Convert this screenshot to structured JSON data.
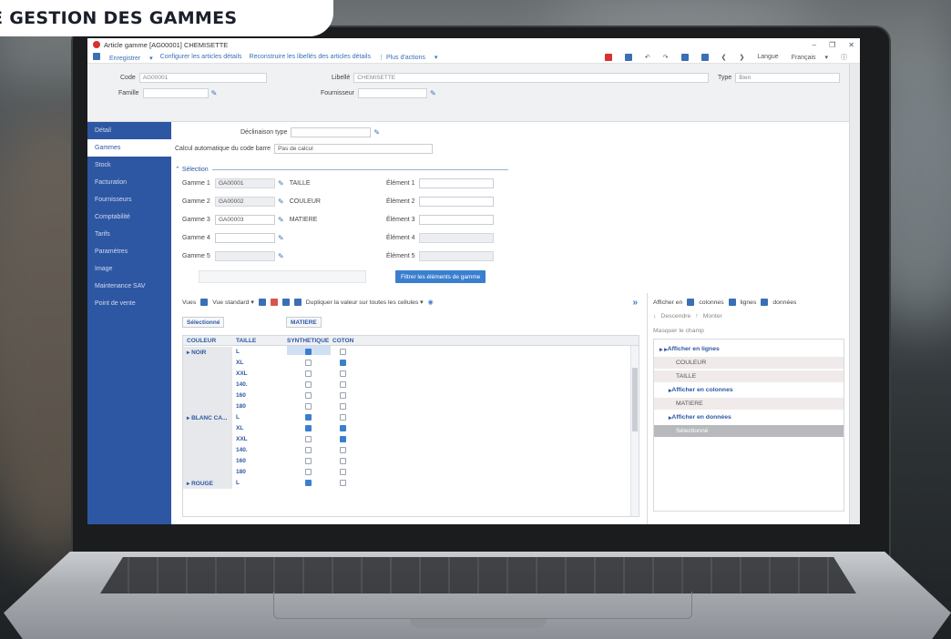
{
  "banner": {
    "text": "E GESTION DES GAMMES"
  },
  "window": {
    "title": "Article gamme [AG00001] CHEMISETTE",
    "controls": [
      "–",
      "❐",
      "✕"
    ]
  },
  "toolbar": {
    "save": "Enregistrer",
    "configure": "Configurer les articles détails",
    "rebuild": "Reconstruire les libellés des articles détails",
    "more": "Plus d'actions",
    "language_label": "Langue",
    "language_value": "Français"
  },
  "header": {
    "code_label": "Code",
    "code_value": "AG00001",
    "libelle_label": "Libellé",
    "libelle_value": "CHEMISETTE",
    "type_label": "Type",
    "type_value": "Bien",
    "famille_label": "Famille",
    "fournisseur_label": "Fournisseur"
  },
  "sidebar": {
    "items": [
      {
        "label": "Détail"
      },
      {
        "label": "Gammes"
      },
      {
        "label": "Stock"
      },
      {
        "label": "Facturation"
      },
      {
        "label": "Fournisseurs"
      },
      {
        "label": "Comptabilité"
      },
      {
        "label": "Tarifs"
      },
      {
        "label": "Paramètres"
      },
      {
        "label": "Image"
      },
      {
        "label": "Maintenance SAV"
      },
      {
        "label": "Point de vente"
      }
    ],
    "active_index": 1
  },
  "form": {
    "declinaison_label": "Déclinaison type",
    "calcul_label": "Calcul automatique du code barre",
    "calcul_value": "Pas de calcul",
    "selection_label": "Sélection",
    "gammes": [
      {
        "label": "Gamme 1",
        "code": "GA00001",
        "name": "TAILLE"
      },
      {
        "label": "Gamme 2",
        "code": "GA00002",
        "name": "COULEUR"
      },
      {
        "label": "Gamme 3",
        "code": "GA00003",
        "name": "MATIERE"
      },
      {
        "label": "Gamme 4",
        "code": "",
        "name": ""
      },
      {
        "label": "Gamme 5",
        "code": "",
        "name": ""
      }
    ],
    "elements": [
      "Élément 1",
      "Élément 2",
      "Élément 3",
      "Élément 4",
      "Élément 5"
    ],
    "filter_button": "Filtrer les éléments de gamme"
  },
  "grid_toolbar": {
    "vues": "Vues",
    "vue_value": "Vue standard",
    "duplicate": "Dupliquer la valeur sur toutes les cellules"
  },
  "tags": {
    "selected": "Sélectionné",
    "matiere": "MATIERE"
  },
  "grid": {
    "headers": {
      "couleur": "COULEUR",
      "taille": "TAILLE",
      "synth": "SYNTHETIQUE",
      "coton": "COTON"
    },
    "groups": [
      {
        "label": "NOIR",
        "rows": [
          {
            "size": "L",
            "synth": true,
            "coton": false
          },
          {
            "size": "XL",
            "synth": false,
            "coton": true
          },
          {
            "size": "XXL",
            "synth": false,
            "coton": false
          },
          {
            "size": "140.",
            "synth": false,
            "coton": false
          },
          {
            "size": "160",
            "synth": false,
            "coton": false
          },
          {
            "size": "180",
            "synth": false,
            "coton": false
          }
        ]
      },
      {
        "label": "BLANC CA...",
        "rows": [
          {
            "size": "L",
            "synth": true,
            "coton": false
          },
          {
            "size": "XL",
            "synth": true,
            "coton": true
          },
          {
            "size": "XXL",
            "synth": false,
            "coton": true
          },
          {
            "size": "140.",
            "synth": false,
            "coton": false
          },
          {
            "size": "160",
            "synth": false,
            "coton": false
          },
          {
            "size": "180",
            "synth": false,
            "coton": false
          }
        ]
      },
      {
        "label": "ROUGE",
        "rows": [
          {
            "size": "L",
            "synth": true,
            "coton": false
          }
        ]
      }
    ]
  },
  "right_panel": {
    "afficher_en": "Afficher en",
    "colonnes": "colonnes",
    "lignes": "lignes",
    "donnees": "données",
    "descendre": "Descendre",
    "monter": "Monter",
    "masquer": "Masquer le champ",
    "tree": [
      {
        "label": "Afficher en lignes",
        "kind": "bold"
      },
      {
        "label": "COULEUR",
        "kind": "leaf"
      },
      {
        "label": "TAILLE",
        "kind": "leaf"
      },
      {
        "label": "Afficher en colonnes",
        "kind": "bold"
      },
      {
        "label": "MATIERE",
        "kind": "leaf"
      },
      {
        "label": "Afficher en données",
        "kind": "bold"
      },
      {
        "label": "Sélectionné",
        "kind": "selrow"
      }
    ]
  },
  "colors": {
    "sidebar": "#2e57a3",
    "accent": "#3a7fcf",
    "titlebar_icon": "#d9312f"
  }
}
